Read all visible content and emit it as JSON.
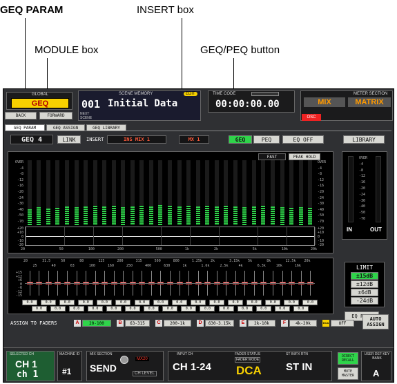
{
  "annotations": {
    "geq_param": "GEQ PARAM",
    "insert_box": "INSERT box",
    "module_box": "MODULE box",
    "geq_peq_button": "GEQ/PEQ button"
  },
  "top": {
    "global": "GLOBAL",
    "geq": "GEQ",
    "back": "BACK",
    "forward": "FORWARD",
    "scene_memory": "SCENE MEMORY",
    "scene_num": "001",
    "scene_title": "Initial Data",
    "next_scene": "NEXT SCENE",
    "edit": "EDIT",
    "time_code": "TIME CODE",
    "time": "00:00:00.00",
    "meter_section": "METER SECTION",
    "mix": "MIX",
    "matrix": "MATRIX",
    "osc": "OSC"
  },
  "tabs": [
    "GEQ PARAM",
    "GEQ ASSIGN",
    "GEQ LIBRARY"
  ],
  "toolbar": {
    "geq_label": "GEQ",
    "module": "4",
    "link": "LINK",
    "insert": "INSERT",
    "insert_source": "INS MIX 1",
    "insert_channel": "MX 1",
    "geq_btn": "GEQ",
    "peq_btn": "PEQ",
    "eq_off": "EQ OFF",
    "library": "LIBRARY"
  },
  "meter_opts": {
    "fast": "FAST",
    "peak_hold": "PEAK HOLD"
  },
  "meter_scale": [
    "OVER",
    "-4",
    "-8",
    "-12",
    "-16",
    "-20",
    "-24",
    "-30",
    "-40",
    "-50",
    "-70"
  ],
  "gain_scale": [
    "+20",
    "+10",
    "0",
    "-10",
    "-20"
  ],
  "freq_axis": [
    "20",
    "50",
    "100",
    "200",
    "500",
    "1k",
    "2k",
    "5k",
    "10k",
    "20k"
  ],
  "io": {
    "in": "IN",
    "out": "OUT"
  },
  "freq_top": [
    "20",
    "31.5",
    "50",
    "80",
    "125",
    "200",
    "315",
    "500",
    "800",
    "1.25k",
    "2k",
    "3.15k",
    "5k",
    "8k",
    "12.5k",
    "20k"
  ],
  "freq_bottom": [
    "25",
    "40",
    "63",
    "100",
    "160",
    "250",
    "400",
    "630",
    "1k",
    "1.6k",
    "2.5k",
    "4k",
    "6.3k",
    "10k",
    "16k"
  ],
  "fader_scale": [
    "+15",
    "+12",
    "+6",
    "0",
    "-6",
    "-12",
    "-15"
  ],
  "band_levels": [
    0.24,
    0.28,
    0.26,
    0.27,
    0.29,
    0.28,
    0.29,
    0.3,
    0.29,
    0.3,
    0.28,
    0.29,
    0.3,
    0.29,
    0.31,
    0.3,
    0.29,
    0.3,
    0.29,
    0.3,
    0.29,
    0.3,
    0.29,
    0.28,
    0.29,
    0.3,
    0.29,
    0.28,
    0.27,
    0.28,
    0.27
  ],
  "band_values": [
    "0.0",
    "0.0",
    "0.0",
    "0.0",
    "0.0",
    "0.0",
    "0.0",
    "0.0",
    "0.0",
    "0.0",
    "0.0",
    "0.0",
    "0.0",
    "0.0",
    "0.0",
    "0.0",
    "0.0",
    "0.0",
    "0.0",
    "0.0",
    "0.0",
    "0.0",
    "0.0",
    "0.0",
    "0.0",
    "0.0",
    "0.0",
    "0.0",
    "0.0",
    "0.0",
    "0.0"
  ],
  "limit": {
    "title": "LIMIT",
    "options": [
      "±15dB",
      "±12dB",
      "±6dB",
      "-24dB"
    ]
  },
  "eq_flat": "EQ FLAT",
  "assign": {
    "label": "ASSIGN TO FADERS",
    "ranges": [
      {
        "letter": "A",
        "range": "20-100"
      },
      {
        "letter": "B",
        "range": "63-315"
      },
      {
        "letter": "C",
        "range": "200-1k"
      },
      {
        "letter": "D",
        "range": "630-3.15k"
      },
      {
        "letter": "E",
        "range": "2k-10k"
      },
      {
        "letter": "F",
        "range": "4k-20k"
      },
      {
        "letter": "DCA",
        "range": "OFF"
      }
    ],
    "auto": "AUTO ASSIGN"
  },
  "bottom": {
    "selected_ch": "SELECTED CH",
    "ch": "CH 1",
    "ch_name": "ch 1",
    "machine_id": "MACHINE ID",
    "machine": "#1",
    "mix_section": "MIX SECTION",
    "send": "SEND",
    "mx": "MX20",
    "ch_level": "CH LEVEL",
    "input_ch": "INPUT CH",
    "ch_range": "CH 1-24",
    "fader_status": "FADER STATUS",
    "fader_mode": "FADER MODE",
    "dca": "DCA",
    "st_in": "ST IN/FX RTN",
    "st_in_big": "ST IN",
    "direct_recall": "DIRECT RECALL",
    "mute_master": "MUTE MASTER",
    "user_def": "USER DEF KEY BANK",
    "bank": "A"
  },
  "colors": {
    "meter_green": "#2fd44a",
    "meter_scale": "#bbbbbb",
    "accent_red": "#ff3b2f",
    "accent_yellow": "#ffd800",
    "panel": "#2f3033"
  }
}
